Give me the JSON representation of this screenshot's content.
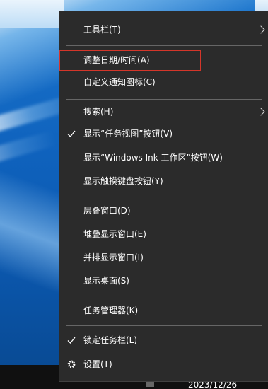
{
  "menu": {
    "items": [
      {
        "label": "工具栏(T)",
        "checked": false,
        "submenu": true
      },
      {
        "label": "调整日期/时间(A)",
        "checked": false,
        "submenu": false,
        "highlighted": true
      },
      {
        "label": "自定义通知图标(C)",
        "checked": false,
        "submenu": false
      },
      {
        "label": "搜索(H)",
        "checked": false,
        "submenu": true
      },
      {
        "label": "显示“任务视图”按钮(V)",
        "checked": true,
        "submenu": false
      },
      {
        "label": "显示“Windows Ink 工作区”按钮(W)",
        "checked": false,
        "submenu": false
      },
      {
        "label": "显示触摸键盘按钮(Y)",
        "checked": false,
        "submenu": false
      },
      {
        "label": "层叠窗口(D)",
        "checked": false,
        "submenu": false
      },
      {
        "label": "堆叠显示窗口(E)",
        "checked": false,
        "submenu": false
      },
      {
        "label": "并排显示窗口(I)",
        "checked": false,
        "submenu": false
      },
      {
        "label": "显示桌面(S)",
        "checked": false,
        "submenu": false
      },
      {
        "label": "任务管理器(K)",
        "checked": false,
        "submenu": false
      },
      {
        "label": "锁定任务栏(L)",
        "checked": true,
        "submenu": false
      },
      {
        "label": "设置(T)",
        "checked": false,
        "submenu": false,
        "icon": "gear-icon"
      }
    ]
  },
  "taskbar": {
    "date": "2023/12/26"
  },
  "colors": {
    "menu_bg": "#2b2b2b",
    "highlight_border": "#d4362a",
    "taskbar_bg": "#101010"
  }
}
